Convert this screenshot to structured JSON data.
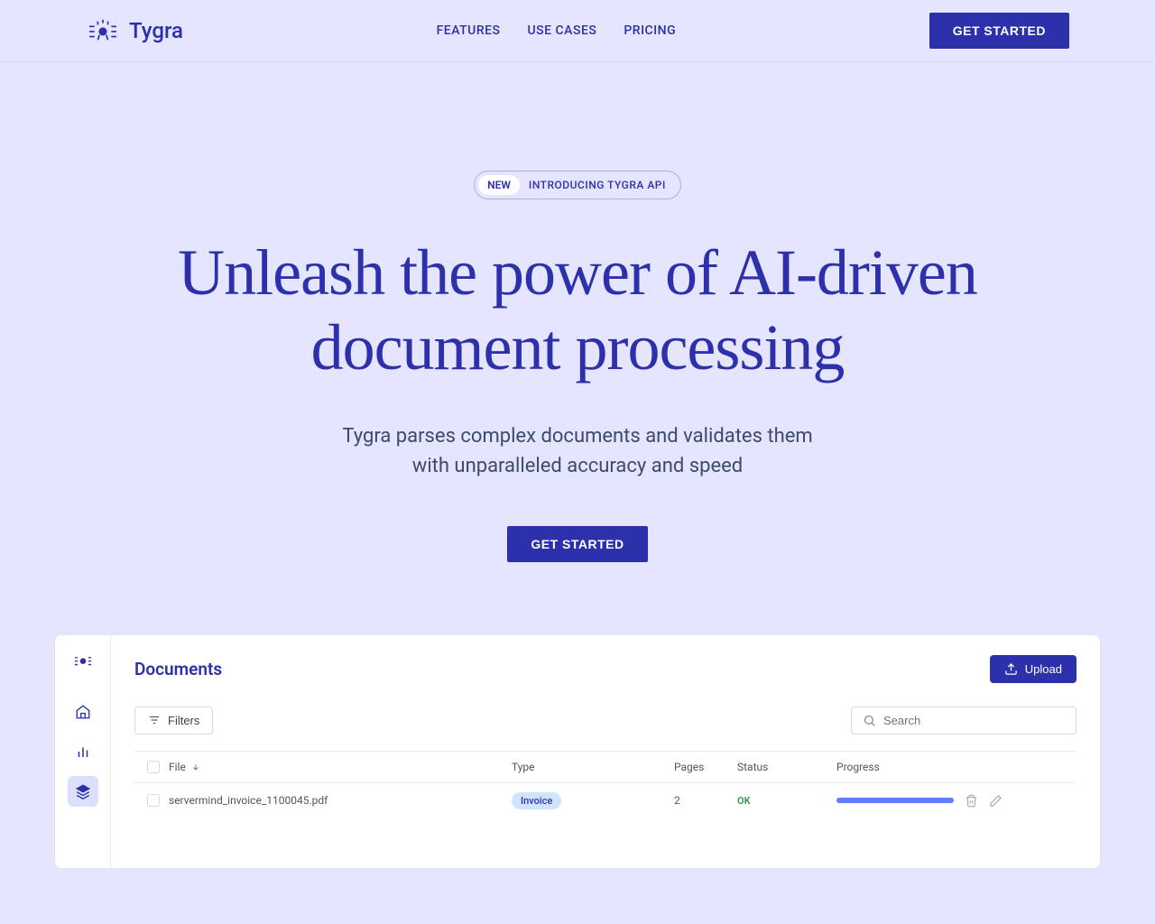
{
  "header": {
    "brand": "Tygra",
    "nav": {
      "features": "FEATURES",
      "use_cases": "USE CASES",
      "pricing": "PRICING"
    },
    "cta": "GET STARTED"
  },
  "hero": {
    "badge_new": "NEW",
    "badge_text": "INTRODUCING TYGRA API",
    "title": "Unleash the power of AI-driven document processing",
    "subtitle_line1": "Tygra parses complex documents and validates them",
    "subtitle_line2": "with unparalleled accuracy and speed",
    "cta": "GET STARTED"
  },
  "app": {
    "title": "Documents",
    "upload": "Upload",
    "filters": "Filters",
    "search_placeholder": "Search",
    "columns": {
      "file": "File",
      "type": "Type",
      "pages": "Pages",
      "status": "Status",
      "progress": "Progress"
    },
    "rows": [
      {
        "file": "servermind_invoice_1100045.pdf",
        "type": "Invoice",
        "pages": "2",
        "status": "OK"
      }
    ]
  }
}
